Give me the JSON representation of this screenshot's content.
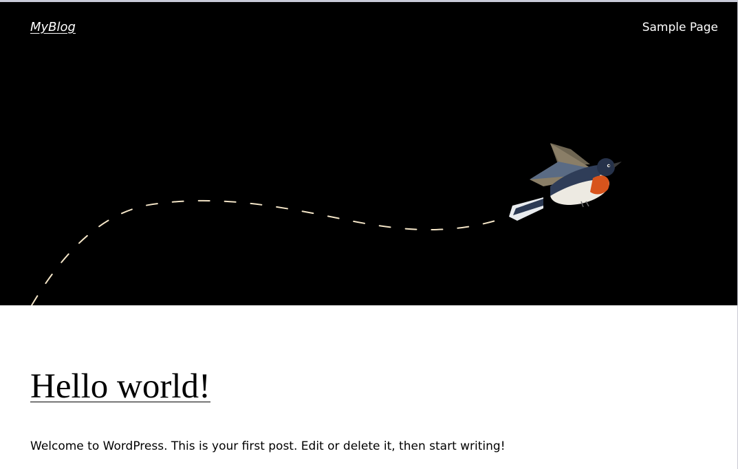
{
  "header": {
    "site_title": "MyBlog",
    "nav_items": [
      "Sample Page"
    ]
  },
  "hero": {
    "background_color": "#000000",
    "trail_color": "#f5e6c8",
    "illustration": "flying-bird"
  },
  "post": {
    "title": "Hello world!",
    "excerpt": "Welcome to WordPress. This is your first post. Edit or delete it, then start writing!"
  }
}
